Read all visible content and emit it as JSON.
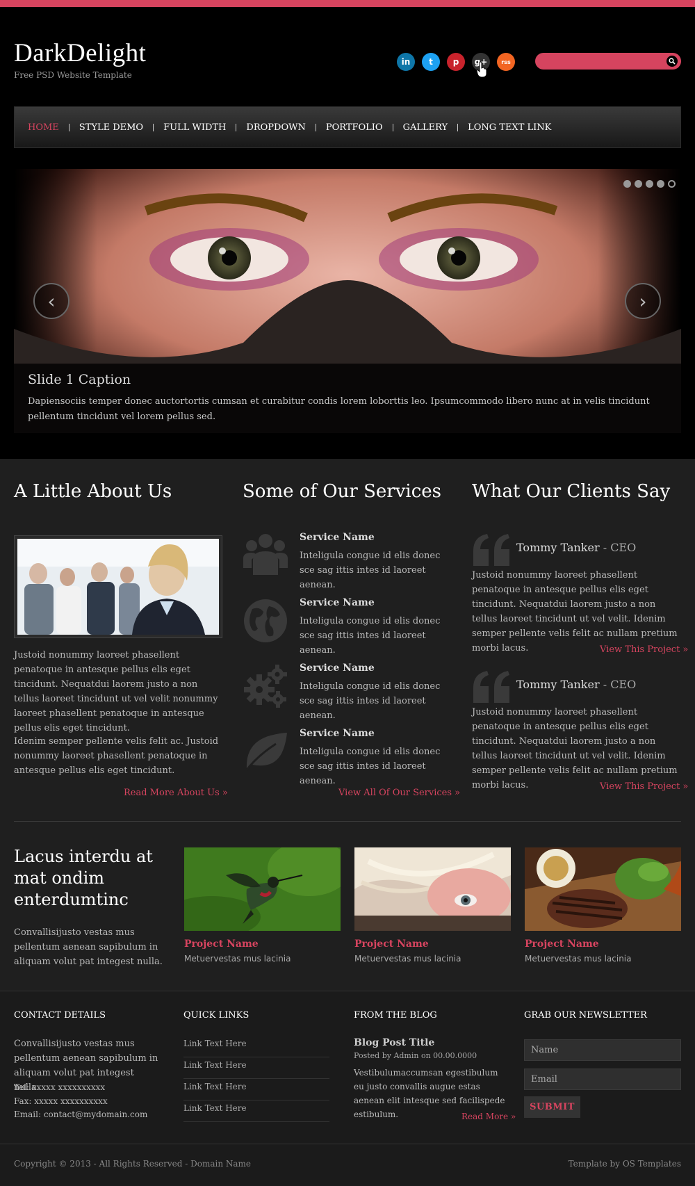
{
  "header": {
    "logo": "DarkDelight",
    "tagline": "Free PSD Website Template",
    "search_placeholder": ""
  },
  "social": [
    {
      "name": "linkedin-icon",
      "glyph": "in",
      "color": "#0e76a8"
    },
    {
      "name": "twitter-icon",
      "glyph": "t",
      "color": "#1da1f2"
    },
    {
      "name": "pinterest-icon",
      "glyph": "p",
      "color": "#c8232c"
    },
    {
      "name": "google-plus-icon",
      "glyph": "g+",
      "color": "#333333"
    },
    {
      "name": "rss-icon",
      "glyph": "rss",
      "color": "#f26522"
    }
  ],
  "nav": [
    {
      "label": "HOME",
      "active": true
    },
    {
      "label": "STYLE DEMO"
    },
    {
      "label": "FULL WIDTH"
    },
    {
      "label": "DROPDOWN"
    },
    {
      "label": "PORTFOLIO"
    },
    {
      "label": "GALLERY"
    },
    {
      "label": "LONG TEXT LINK"
    }
  ],
  "slider": {
    "caption_title": "Slide 1 Caption",
    "caption_text": "Dapiensociis temper donec auctortortis cumsan et curabitur condis lorem loborttis leo. Ipsumcommodo libero nunc at in velis tincidunt pellentum tincidunt vel lorem pellus sed.",
    "prev": "‹",
    "next": "›"
  },
  "about": {
    "title": "A Little About Us",
    "p1": "Justoid nonummy laoreet phasellent penatoque in antesque pellus elis eget tincidunt. Nequatdui laorem justo a non tellus laoreet tincidunt ut vel velit nonummy laoreet phasellent penatoque in antesque pellus elis eget tincidunt.",
    "p2": "Idenim semper pellente velis felit ac. Justoid nonummy laoreet phasellent penatoque in antesque pellus elis eget tincidunt.",
    "link": "Read More About Us »"
  },
  "services": {
    "title": "Some of Our Services",
    "items": [
      {
        "name": "Service Name",
        "text": "Inteligula congue id elis donec sce sag ittis intes id laoreet aenean.",
        "icon": "people-icon"
      },
      {
        "name": "Service Name",
        "text": "Inteligula congue id elis donec sce sag ittis intes id laoreet aenean.",
        "icon": "globe-icon"
      },
      {
        "name": "Service Name",
        "text": "Inteligula congue id elis donec sce sag ittis intes id laoreet aenean.",
        "icon": "gears-icon"
      },
      {
        "name": "Service Name",
        "text": "Inteligula congue id elis donec sce sag ittis intes id laoreet aenean.",
        "icon": "leaf-icon"
      }
    ],
    "link": "View All Of Our Services »"
  },
  "clients": {
    "title": "What Our Clients Say",
    "items": [
      {
        "name": "Tommy Tanker",
        "role": " - CEO",
        "text": "Justoid nonummy laoreet phasellent penatoque in antesque pellus elis eget tincidunt. Nequatdui laorem justo a non tellus laoreet tincidunt ut vel velit. Idenim semper pellente velis felit ac nullam pretium morbi lacus.",
        "link": "View This Project »"
      },
      {
        "name": "Tommy Tanker",
        "role": " - CEO",
        "text": "Justoid nonummy laoreet phasellent penatoque in antesque pellus elis eget tincidunt. Nequatdui laorem justo a non tellus laoreet tincidunt ut vel velit. Idenim semper pellente velis felit ac nullam pretium morbi lacus.",
        "link": "View This Project »"
      }
    ]
  },
  "projects": {
    "title": "Lacus interdu at mat ondim enterdumtinc",
    "text": "Convallisijusto vestas mus pellentum aenean sapibulum in aliquam volut pat integest nulla.",
    "items": [
      {
        "name": "Project Name",
        "sub": "Metuervestas mus lacinia"
      },
      {
        "name": "Project Name",
        "sub": "Metuervestas mus lacinia"
      },
      {
        "name": "Project Name",
        "sub": "Metuervestas mus lacinia"
      }
    ]
  },
  "footer": {
    "contact": {
      "title": "CONTACT DETAILS",
      "text": "Convallisijusto vestas mus pellentum aenean sapibulum in aliquam volut pat integest nulla.",
      "tel": "Tel: xxxxx xxxxxxxxxx",
      "fax": "Fax: xxxxx xxxxxxxxxx",
      "email": "Email: contact@mydomain.com"
    },
    "quick": {
      "title": "QUICK LINKS",
      "links": [
        "Link Text Here",
        "Link Text Here",
        "Link Text Here",
        "Link Text Here"
      ]
    },
    "blog": {
      "title": "FROM THE BLOG",
      "post_title": "Blog Post Title",
      "meta": "Posted by Admin on 00.00.0000",
      "text": "Vestibulumaccumsan egestibulum eu justo convallis augue estas aenean elit intesque sed facilispede estibulum.",
      "link": "Read More »"
    },
    "newsletter": {
      "title": "GRAB OUR NEWSLETTER",
      "name_placeholder": "Name",
      "email_placeholder": "Email",
      "submit": "SUBMIT"
    },
    "copyright": "Copyright © 2013 - All Rights Reserved - Domain Name",
    "credit": "Template by OS Templates"
  },
  "colors": {
    "accent": "#d6445f",
    "background": "#1f1f1f",
    "header": "#000000"
  }
}
